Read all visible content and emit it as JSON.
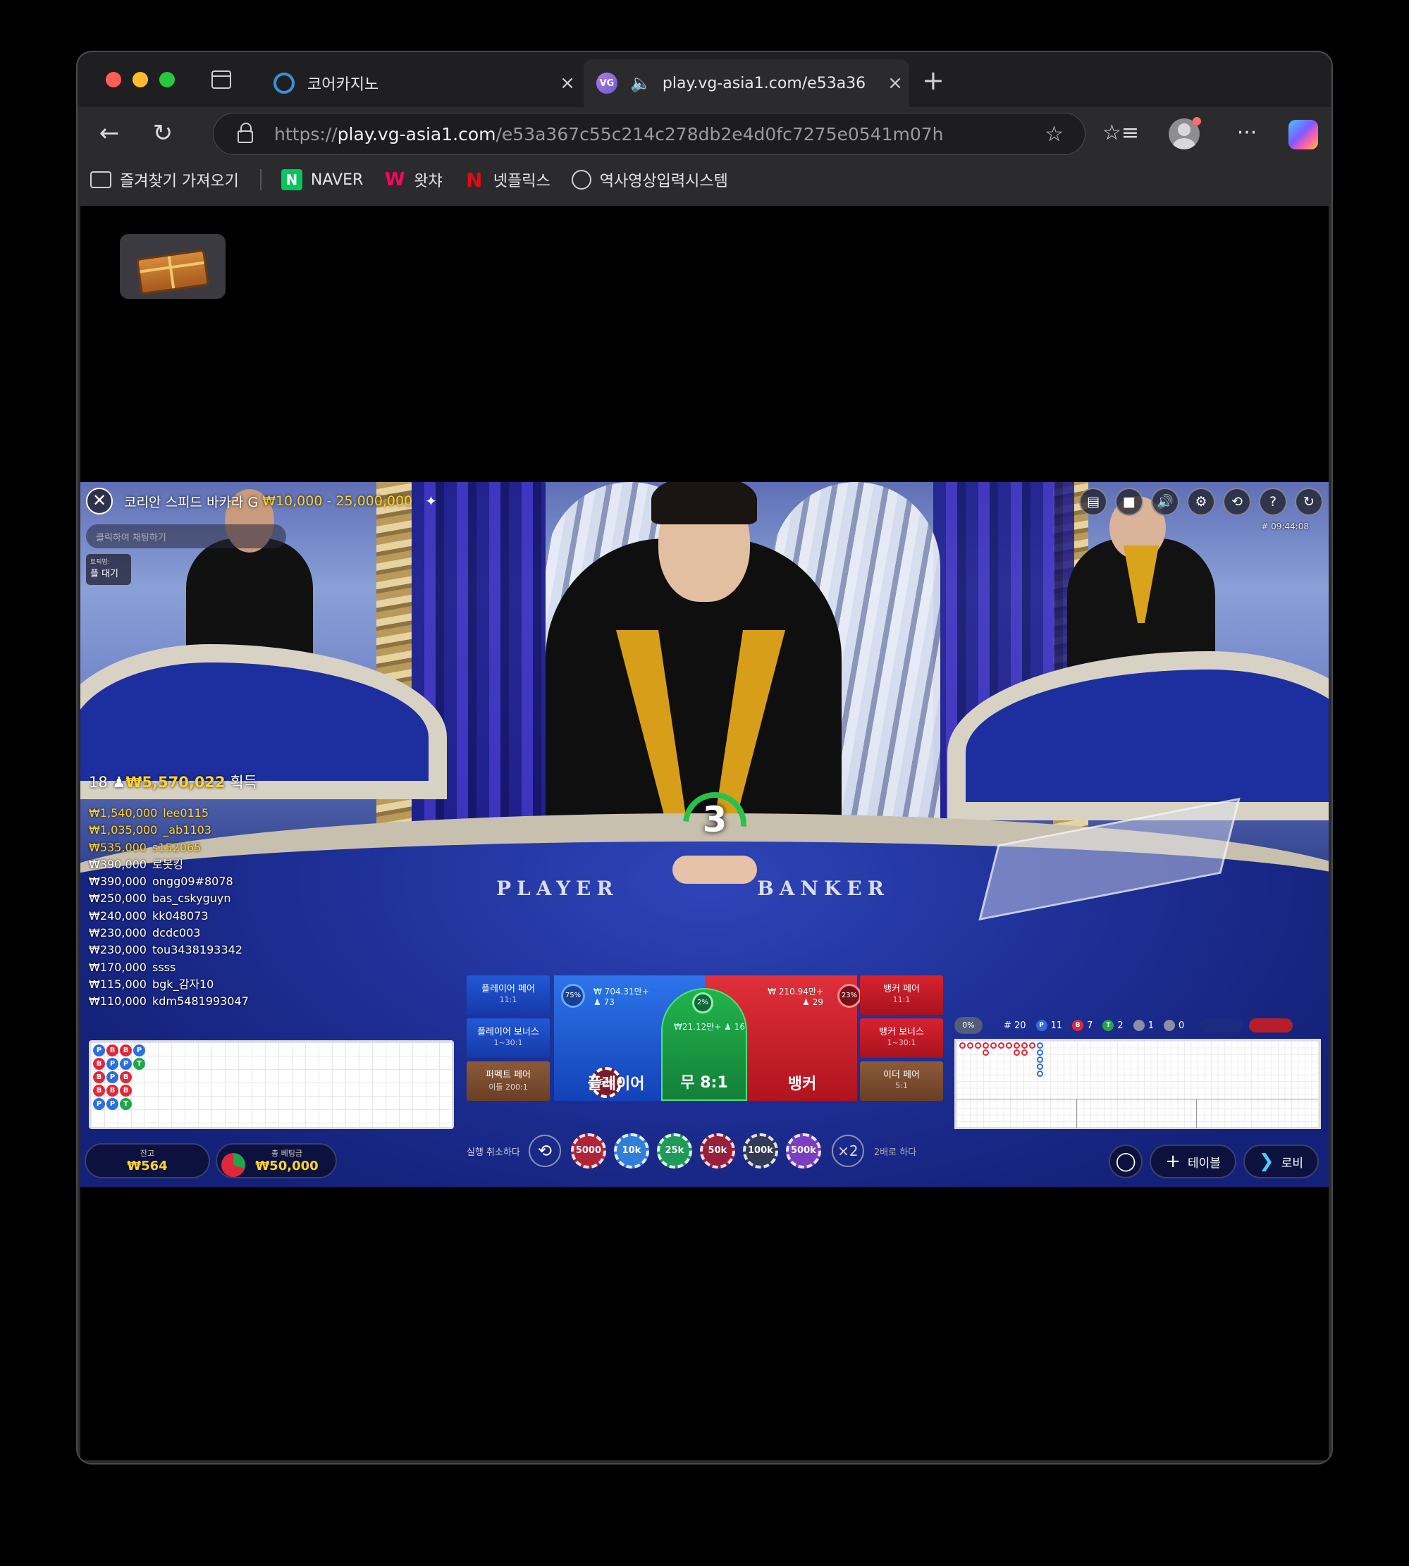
{
  "browser": {
    "tabs": [
      {
        "title": "코어카지노",
        "close": "×"
      },
      {
        "title": "play.vg-asia1.com/e53a36",
        "close": "×"
      }
    ],
    "new_tab": "+",
    "url_prefix": "https://",
    "url_host": "play.vg-asia1.com",
    "url_path": "/e53a367c55c214c278db2e4d0fc7275e0541m07h",
    "bookmarks": [
      "즐겨찾기 가져오기",
      "NAVER",
      "왓챠",
      "넷플릭스",
      "역사영상입력시스템"
    ],
    "icons": {
      "back": "←",
      "reload": "↻",
      "star": "☆",
      "favorites": "☆≡",
      "more": "···",
      "naver": "N",
      "watcha": "W",
      "netflix": "N",
      "speaker": "🔈",
      "vg": "VG"
    }
  },
  "game": {
    "table_name": "코리안 스피드 바카라 G",
    "table_limit": "₩10,000 - 25,000,000",
    "pin": "✦",
    "close": "✕",
    "chat_placeholder": "클릭하여 채팅하기",
    "queue_small": "토픽멈:",
    "queue_main": "플 대기",
    "game_id": "# 09:44:08",
    "controls": [
      "▤",
      "■",
      "🔊",
      "⚙",
      "⟲",
      "?",
      "↻"
    ],
    "countdown": "3",
    "felt_player": "PLAYER",
    "felt_banker": "BANKER",
    "winners_count": "18",
    "winners_icon": "♟",
    "winners_total": "₩5,570,022",
    "winners_suffix": "획득",
    "winners": [
      {
        "amount": "₩1,540,000",
        "nick": "lee0115"
      },
      {
        "amount": "₩1,035,000",
        "nick": "_ab1103"
      },
      {
        "amount": "₩535,000",
        "nick": "s152065"
      },
      {
        "amount": "₩390,000",
        "nick": "로봇킹"
      },
      {
        "amount": "₩390,000",
        "nick": "ongg09#8078"
      },
      {
        "amount": "₩250,000",
        "nick": "bas_cskyguyn"
      },
      {
        "amount": "₩240,000",
        "nick": "kk048073"
      },
      {
        "amount": "₩230,000",
        "nick": "dcdc003"
      },
      {
        "amount": "₩230,000",
        "nick": "tou3438193342"
      },
      {
        "amount": "₩170,000",
        "nick": "ssss"
      },
      {
        "amount": "₩115,000",
        "nick": "bgk_감자10"
      },
      {
        "amount": "₩110,000",
        "nick": "kdm5481993047"
      }
    ],
    "bead_road": [
      [
        "P",
        "B",
        "B",
        "B",
        "P"
      ],
      [
        "B",
        "P",
        "P",
        "B",
        "P"
      ],
      [
        "B",
        "P",
        "B",
        "B",
        "T"
      ],
      [
        "P",
        "T",
        "",
        "",
        ""
      ]
    ],
    "balance_label": "잔고",
    "balance_value": "₩564",
    "totalbet_label": "총 베팅금",
    "totalbet_value": "₩50,000",
    "bets": {
      "player_pair": {
        "label": "플레이어 페어",
        "odds": "11:1"
      },
      "player_bonus": {
        "label": "플레이어 보너스",
        "odds": "1~30:1"
      },
      "perfect_pair": {
        "label": "퍼펙트 페어",
        "odds": "이들 200:1"
      },
      "banker_pair": {
        "label": "뱅커 페어",
        "odds": "11:1"
      },
      "banker_bonus": {
        "label": "뱅커 보너스",
        "odds": "1~30:1"
      },
      "either_pair": {
        "label": "이더 페어",
        "odds": "5:1"
      },
      "player": {
        "label": "플레이어",
        "pct": "75%",
        "amount": "₩ 704.31만+",
        "players": "♟ 73",
        "chip": "50k"
      },
      "tie": {
        "label": "무 8:1",
        "pct": "2%",
        "amount": "₩21.12만+",
        "players": "♟ 16"
      },
      "banker": {
        "label": "뱅커",
        "pct": "23%",
        "amount": "₩ 210.94만+",
        "players": "♟ 29"
      }
    },
    "undo_label": "실행 취소하다",
    "undo_icon": "⟲",
    "chips": [
      {
        "label": "5000",
        "color": "#b0243a"
      },
      {
        "label": "10k",
        "color": "#2f7fd8"
      },
      {
        "label": "25k",
        "color": "#1f9a5a"
      },
      {
        "label": "50k",
        "color": "#9a1f3a"
      },
      {
        "label": "100k",
        "color": "#333a55"
      },
      {
        "label": "500k",
        "color": "#7a3fc0"
      }
    ],
    "double_icon": "×2",
    "double_label": "2배로 하다",
    "road_stats": {
      "pct": "0%",
      "rounds": "# 20",
      "player": "11",
      "banker": "7",
      "tie": "2",
      "player_pair": "1",
      "banker_pair": "0",
      "p_letter": "P",
      "b_letter": "B",
      "t_letter": "T"
    },
    "bottom_buttons": {
      "chat_icon": "◯",
      "table_icon": "+",
      "table_label": "테이블",
      "lobby_icon": "❯",
      "lobby_label": "로비"
    }
  }
}
